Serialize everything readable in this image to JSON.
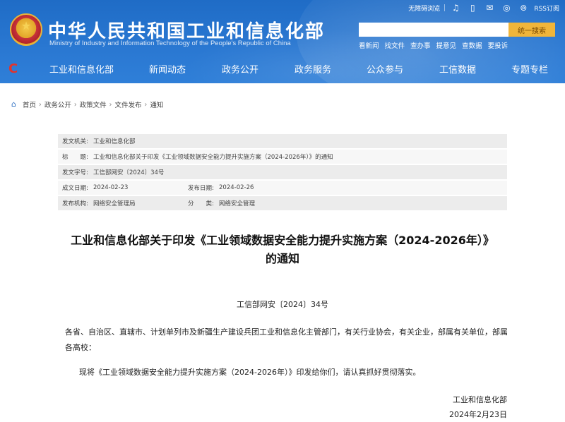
{
  "header": {
    "title": "中华人民共和国工业和信息化部",
    "subtitle": "Ministry of Industry and Information Technology of the People's Republic of China",
    "top_links": {
      "accessibility": "无障碍浏览",
      "rss": "RSS订阅"
    },
    "search": {
      "placeholder": "",
      "button": "统一搜索"
    },
    "quick_links": [
      "看新闻",
      "找文件",
      "查办事",
      "提意见",
      "查数据",
      "要投诉"
    ],
    "nav": [
      "工业和信息化部",
      "新闻动态",
      "政务公开",
      "政务服务",
      "公众参与",
      "工信数据",
      "专题专栏"
    ]
  },
  "breadcrumb": [
    "首页",
    "政务公开",
    "政策文件",
    "文件发布",
    "通知"
  ],
  "meta": {
    "issuer_label": "发文机关:",
    "issuer": "工业和信息化部",
    "title_label": "标　　题:",
    "title": "工业和信息化部关于印发《工业领域数据安全能力提升实施方案（2024-2026年）》的通知",
    "doc_no_label": "发文字号:",
    "doc_no": "工信部网安〔2024〕34号",
    "created_label": "成文日期:",
    "created": "2024-02-23",
    "published_label": "发布日期:",
    "published": "2024-02-26",
    "org_label": "发布机构:",
    "org": "网络安全管理局",
    "category_label": "分　　类:",
    "category": "网络安全管理"
  },
  "document": {
    "title_line1": "工业和信息化部关于印发《工业领域数据安全能力提升实施方案（2024-2026年）》",
    "title_line2": "的通知",
    "number": "工信部网安〔2024〕34号",
    "recipient": "各省、自治区、直辖市、计划单列市及新疆生产建设兵团工业和信息化主管部门，有关行业协会，有关企业，部属有关单位，部属各高校：",
    "body": "现将《工业领域数据安全能力提升实施方案（2024-2026年）》印发给你们，请认真抓好贯彻落实。",
    "sign_org": "工业和信息化部",
    "sign_date": "2024年2月23日"
  }
}
